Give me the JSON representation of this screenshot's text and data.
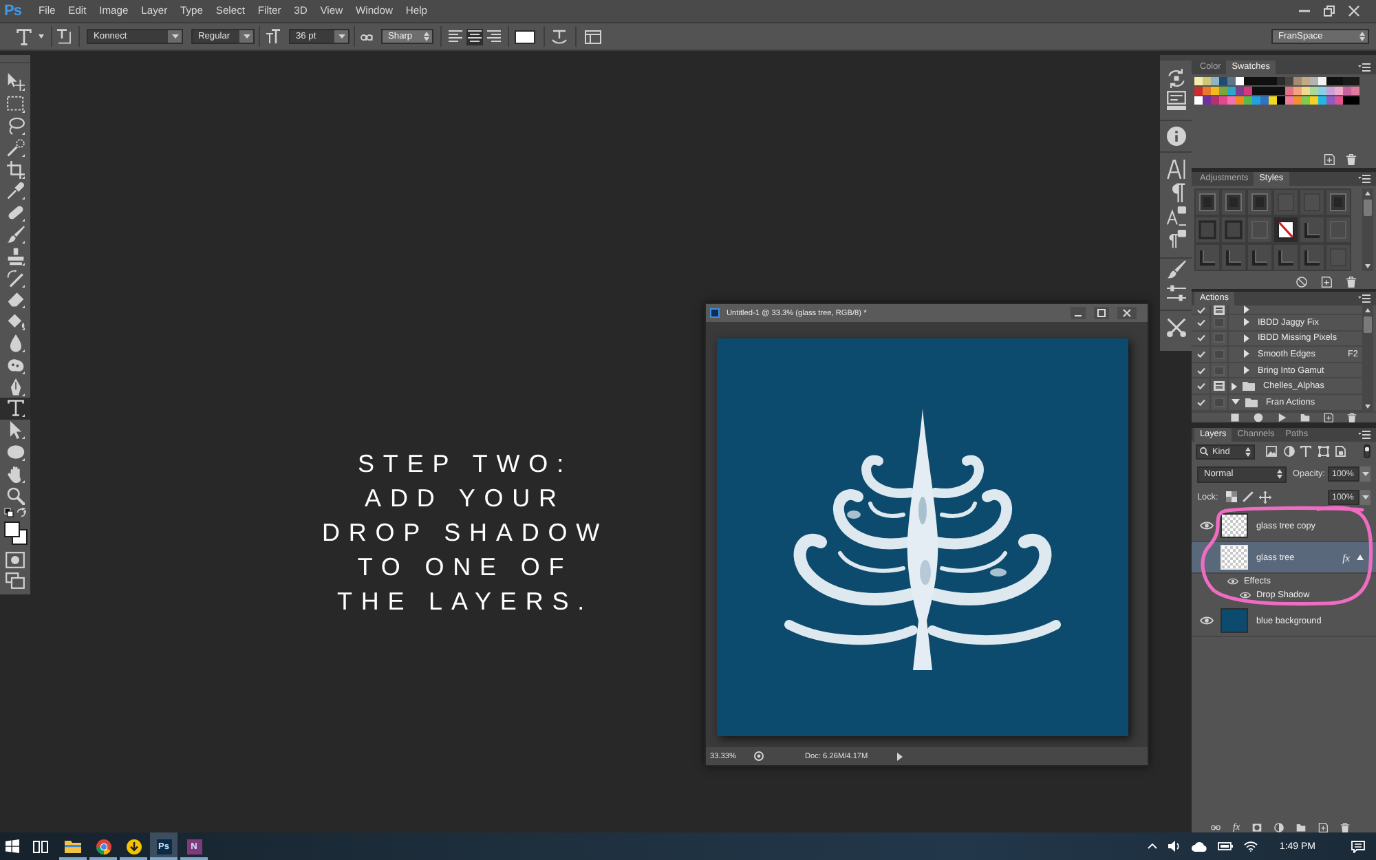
{
  "menubar": {
    "logo": "Ps",
    "items": [
      "File",
      "Edit",
      "Image",
      "Layer",
      "Type",
      "Select",
      "Filter",
      "3D",
      "View",
      "Window",
      "Help"
    ]
  },
  "options_bar": {
    "font_family": "Konnect",
    "font_style": "Regular",
    "font_size": "36 pt",
    "antialiasing": "Sharp",
    "alignment": [
      {
        "kind": "left",
        "selected": false
      },
      {
        "kind": "center",
        "selected": true
      },
      {
        "kind": "right",
        "selected": false
      }
    ],
    "workspace": "FranSpace"
  },
  "tools": [
    {
      "kind": "move",
      "selected": false
    },
    {
      "kind": "marquee",
      "selected": false
    },
    {
      "kind": "lasso",
      "selected": false
    },
    {
      "kind": "quick-select",
      "selected": false
    },
    {
      "kind": "crop",
      "selected": false
    },
    {
      "kind": "eyedropper",
      "selected": false
    },
    {
      "kind": "healing",
      "selected": false
    },
    {
      "kind": "brush",
      "selected": false
    },
    {
      "kind": "stamp",
      "selected": false
    },
    {
      "kind": "history-brush",
      "selected": false
    },
    {
      "kind": "eraser",
      "selected": false
    },
    {
      "kind": "bucket",
      "selected": false
    },
    {
      "kind": "blur",
      "selected": false
    },
    {
      "kind": "sponge",
      "selected": false
    },
    {
      "kind": "pen",
      "selected": false
    },
    {
      "kind": "type",
      "selected": true
    },
    {
      "kind": "path-select",
      "selected": false
    },
    {
      "kind": "shape",
      "selected": false
    },
    {
      "kind": "hand",
      "selected": false
    },
    {
      "kind": "zoom",
      "selected": false
    }
  ],
  "modes": [
    {
      "kind": "quick-mask"
    },
    {
      "kind": "screen-mode"
    }
  ],
  "caption": {
    "lines": [
      "STEP TWO:",
      "ADD YOUR",
      "DROP SHADOW",
      "TO ONE OF",
      "THE LAYERS."
    ]
  },
  "document": {
    "title": "Untitled-1 @ 33.3% (glass tree, RGB/8) *",
    "zoom": "33.33%",
    "info": "Doc: 6.26M/4.17M"
  },
  "dock": {
    "groups": [
      {
        "icons": [
          {
            "kind": "history"
          },
          {
            "kind": "properties"
          }
        ]
      },
      {
        "icons": [
          {
            "kind": "info"
          }
        ]
      },
      {
        "icons": [
          {
            "kind": "character"
          },
          {
            "kind": "paragraph"
          },
          {
            "kind": "character-styles"
          },
          {
            "kind": "paragraph-styles"
          }
        ]
      },
      {
        "icons": [
          {
            "kind": "brush"
          },
          {
            "kind": "adjust"
          }
        ]
      },
      {
        "icons": [
          {
            "kind": "tools"
          }
        ]
      }
    ]
  },
  "swatches_panel": {
    "tabs": [
      {
        "label": "Color",
        "selected": false
      },
      {
        "label": "Swatches",
        "selected": true
      }
    ],
    "swatches": [
      {
        "color": "#f4eca8"
      },
      {
        "color": "#cfc67e"
      },
      {
        "color": "#8db7c9"
      },
      {
        "color": "#1e4b72"
      },
      {
        "color": "#5f7688"
      },
      {
        "color": "#ffffff"
      },
      {
        "color": "#101010"
      },
      {
        "color": "#101010"
      },
      {
        "color": "#101010"
      },
      {
        "color": "#101010"
      },
      {
        "color": "#2b2b2b"
      },
      {
        "color": "#4a4441"
      },
      {
        "color": "#a48d6e"
      },
      {
        "color": "#c2ab84"
      },
      {
        "color": "#b3b3b3"
      },
      {
        "color": "#f2f2f2"
      },
      {
        "color": "#101010"
      },
      {
        "color": "#101010"
      },
      {
        "color": "#1a1a1a"
      },
      {
        "color": "#1a1a1a"
      },
      {
        "color": "#cf2b2b"
      },
      {
        "color": "#e6792b"
      },
      {
        "color": "#f0b91f"
      },
      {
        "color": "#79a83a"
      },
      {
        "color": "#2aa8c9"
      },
      {
        "color": "#7a3d91"
      },
      {
        "color": "#d13b7b"
      },
      {
        "color": "#101010"
      },
      {
        "color": "#101010"
      },
      {
        "color": "#101010"
      },
      {
        "color": "#101010"
      },
      {
        "color": "#e27382"
      },
      {
        "color": "#f1a37f"
      },
      {
        "color": "#f1d98f"
      },
      {
        "color": "#a9d897"
      },
      {
        "color": "#89d0e7"
      },
      {
        "color": "#c9a1d9"
      },
      {
        "color": "#f0a9c9"
      },
      {
        "color": "#c8619f"
      },
      {
        "color": "#e0799a"
      },
      {
        "color": "#ffffff"
      },
      {
        "color": "#71309f"
      },
      {
        "color": "#b13171"
      },
      {
        "color": "#e1488f"
      },
      {
        "color": "#f171b1"
      },
      {
        "color": "#f18921"
      },
      {
        "color": "#59b849"
      },
      {
        "color": "#21a1e1"
      },
      {
        "color": "#3171c1"
      },
      {
        "color": "#f1d921"
      },
      {
        "color": "#000000"
      },
      {
        "color": "#f17999"
      },
      {
        "color": "#f19131"
      },
      {
        "color": "#81c951"
      },
      {
        "color": "#f1d121"
      },
      {
        "color": "#21b9e1"
      },
      {
        "color": "#9159c1"
      },
      {
        "color": "#e15191"
      },
      {
        "color": "#000000"
      },
      {
        "color": "#000000"
      }
    ]
  },
  "styles_panel": {
    "tabs": [
      {
        "label": "Adjustments",
        "selected": false
      },
      {
        "label": "Styles",
        "selected": true
      }
    ],
    "styles": [
      {
        "kind": "inset",
        "selected": false
      },
      {
        "kind": "inset",
        "selected": false
      },
      {
        "kind": "inset",
        "selected": false
      },
      {
        "kind": "plain",
        "selected": false
      },
      {
        "kind": "plain",
        "selected": false
      },
      {
        "kind": "inset",
        "selected": false
      },
      {
        "kind": "frame",
        "selected": false
      },
      {
        "kind": "frame",
        "selected": false
      },
      {
        "kind": "faint",
        "selected": false
      },
      {
        "kind": "none",
        "selected": true
      },
      {
        "kind": "corner",
        "selected": false
      },
      {
        "kind": "faint",
        "selected": false
      },
      {
        "kind": "corner",
        "selected": false
      },
      {
        "kind": "corner",
        "selected": false
      },
      {
        "kind": "corner",
        "selected": false
      },
      {
        "kind": "corner",
        "selected": false
      },
      {
        "kind": "corner",
        "selected": false
      },
      {
        "kind": "plain",
        "selected": false
      }
    ]
  },
  "actions_panel": {
    "tabs": [
      {
        "label": "Actions",
        "selected": true
      }
    ],
    "items": [
      {
        "kind": "action",
        "checked": true,
        "dialog": true,
        "expanded": false
      },
      {
        "kind": "action",
        "name": "IBDD Jaggy Fix",
        "checked": true,
        "dialog": false,
        "expanded": false
      },
      {
        "kind": "action",
        "name": "IBDD Missing Pixels",
        "checked": true,
        "dialog": false,
        "expanded": false
      },
      {
        "kind": "action",
        "name": "Smooth Edges",
        "shortcut": "F2",
        "checked": true,
        "dialog": false,
        "expanded": false
      },
      {
        "kind": "action",
        "name": "Bring Into Gamut",
        "checked": true,
        "dialog": false,
        "expanded": false
      },
      {
        "kind": "set",
        "name": "Chelles_Alphas",
        "checked": true,
        "dialog": true,
        "expanded": false
      },
      {
        "kind": "set",
        "name": "Fran Actions",
        "checked": true,
        "dialog": false,
        "expanded": true
      }
    ]
  },
  "layers_panel": {
    "tabs": [
      {
        "label": "Layers",
        "selected": true
      },
      {
        "label": "Channels",
        "selected": false
      },
      {
        "label": "Paths",
        "selected": false
      }
    ],
    "filter": "Kind",
    "filter_enabled": true,
    "blend_mode": "Normal",
    "opacity_label": "Opacity:",
    "opacity": "100%",
    "lock_label": "Lock:",
    "fill": "100%",
    "layers": [
      {
        "name": "glass tree copy",
        "kind": "transparent",
        "visible": true,
        "selected": false
      },
      {
        "name": "glass tree",
        "kind": "transparent",
        "visible": false,
        "selected": true,
        "badge": "fx",
        "expanded": true,
        "children": [
          {
            "name": "Effects",
            "visible": true,
            "children": [
              {
                "name": "Drop Shadow",
                "visible": true
              }
            ]
          }
        ]
      },
      {
        "name": "blue background",
        "kind": "solid",
        "visible": true,
        "selected": false
      }
    ],
    "footer": {
      "effects_label": "fx"
    }
  },
  "taskbar": {
    "apps": [
      {
        "kind": "explorer",
        "selected": false
      },
      {
        "kind": "browser",
        "selected": false
      },
      {
        "kind": "download",
        "selected": false
      },
      {
        "kind": "tile",
        "label": "Ps",
        "color": "#0b2a45",
        "selected": true
      },
      {
        "kind": "tile",
        "label": "N",
        "color": "#80397b",
        "selected": false
      }
    ],
    "time": "1:49 PM"
  }
}
